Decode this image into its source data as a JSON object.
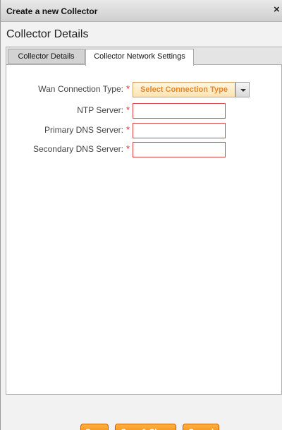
{
  "dialog": {
    "title": "Create a new Collector",
    "close_glyph": "×",
    "section_title": "Collector Details"
  },
  "tabs": [
    {
      "label": "Collector Details",
      "active": false
    },
    {
      "label": "Collector Network Settings",
      "active": true
    }
  ],
  "form": {
    "wan_label": "Wan Connection Type:",
    "wan_selected": "Select Connection Type",
    "ntp_label": "NTP Server:",
    "ntp_value": "",
    "primary_dns_label": "Primary DNS Server:",
    "primary_dns_value": "",
    "secondary_dns_label": "Secondary DNS Server:",
    "secondary_dns_value": "",
    "required_marker": "*"
  },
  "buttons": {
    "save": "Save",
    "save_close": "Save & Close",
    "cancel": "Cancel"
  },
  "colors": {
    "accent": "#ec7410",
    "required": "#d63030",
    "select_text": "#e8862a"
  }
}
